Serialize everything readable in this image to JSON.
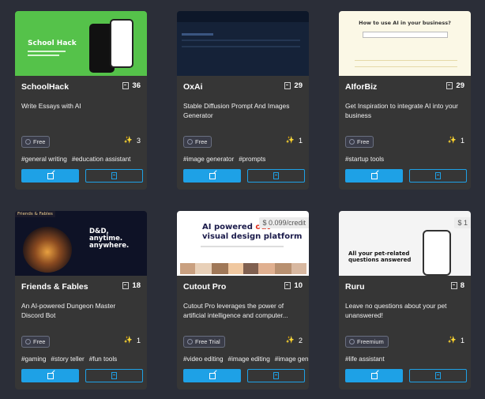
{
  "cards": [
    {
      "name": "SchoolHack",
      "saves": "36",
      "desc": "Write Essays with AI",
      "badge": "Free",
      "uses": "3",
      "tags": [
        "#general writing",
        "#education assistant"
      ],
      "thumb": {
        "bg": "#55c24a",
        "headline": "School Hack"
      }
    },
    {
      "name": "OxAi",
      "saves": "29",
      "desc": "Stable Diffusion Prompt And Images Generator",
      "badge": "Free",
      "uses": "1",
      "tags": [
        "#image generator",
        "#prompts"
      ],
      "thumb": {
        "bg": "#152238"
      }
    },
    {
      "name": "AIforBiz",
      "saves": "29",
      "desc": "Get Inspiration to integrate AI into your business",
      "badge": "Free",
      "uses": "1",
      "tags": [
        "#startup tools"
      ],
      "thumb": {
        "bg": "#fbf8e6",
        "headline": "How to use AI in your business?"
      }
    },
    {
      "name": "Friends & Fables",
      "saves": "18",
      "desc": "An AI-powered Dungeon Master Discord Bot",
      "badge": "Free",
      "uses": "1",
      "tags": [
        "#gaming",
        "#story teller",
        "#fun tools"
      ],
      "thumb": {
        "bg": "#0e1226",
        "headline": "D&D, anytime. anywhere.",
        "corner": "Friends & Fables"
      }
    },
    {
      "name": "Cutout Pro",
      "saves": "10",
      "desc": "Cutout Pro leverages the power of artificial intelligence and computer...",
      "badge": "Free Trial",
      "uses": "2",
      "tags": [
        "#video editing",
        "#image editing",
        "#image generator"
      ],
      "price": "$ 0.099/credit",
      "thumb": {
        "bg": "#ffffff",
        "headline": "AI powered",
        "accent": "out",
        "headline2": "visual design platform"
      }
    },
    {
      "name": "Ruru",
      "saves": "8",
      "desc": "Leave no questions about your pet unanswered!",
      "badge": "Freemium",
      "uses": "1",
      "tags": [
        "#life assistant"
      ],
      "price": "$ 1",
      "thumb": {
        "bg": "#f4f4f4",
        "headline": "All your pet-related questions answered"
      }
    }
  ]
}
